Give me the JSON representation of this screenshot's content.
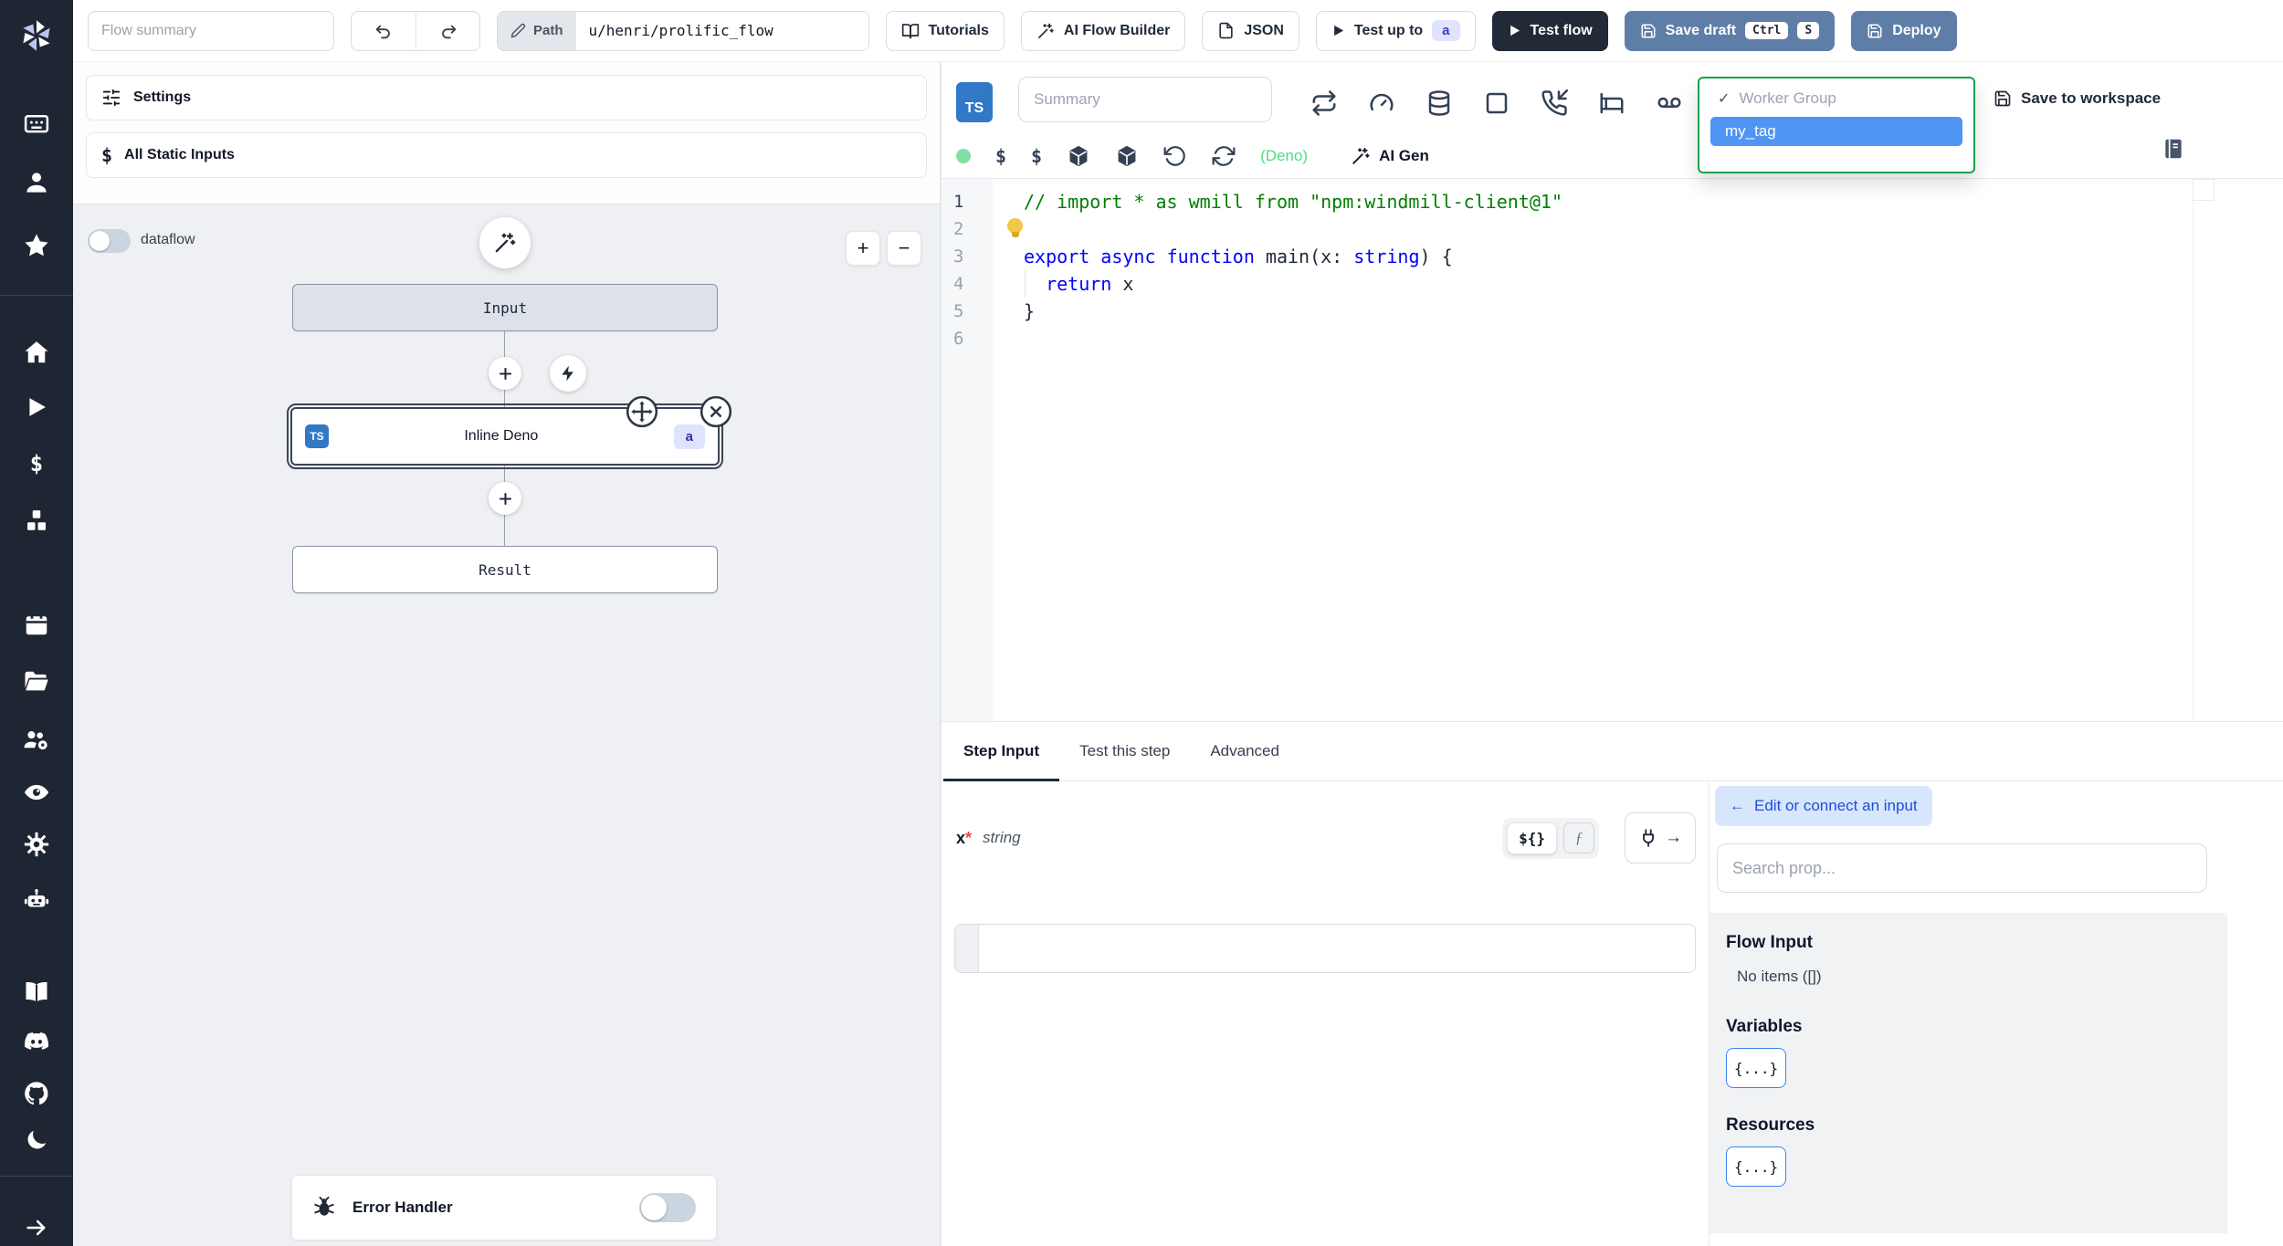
{
  "topbar": {
    "flow_summary_placeholder": "Flow summary",
    "path_label": "Path",
    "path_value": "u/henri/prolific_flow",
    "tutorials_label": "Tutorials",
    "ai_flow_builder_label": "AI Flow Builder",
    "json_label": "JSON",
    "test_up_to_label": "Test up to",
    "test_up_to_badge": "a",
    "test_flow_label": "Test flow",
    "save_draft_label": "Save draft",
    "save_draft_kbd": [
      "Ctrl",
      "S"
    ],
    "deploy_label": "Deploy"
  },
  "flow_panel": {
    "settings_label": "Settings",
    "all_static_inputs_label": "All Static Inputs",
    "dataflow_label": "dataflow",
    "zoom_in_label": "+",
    "zoom_out_label": "−",
    "error_handler_label": "Error Handler"
  },
  "graph": {
    "input_node_label": "Input",
    "step_node": {
      "lang_badge": "TS",
      "label": "Inline Deno",
      "id_badge": "a"
    },
    "result_node_label": "Result"
  },
  "editor": {
    "lang_badge": "TS",
    "summary_placeholder": "Summary",
    "language_indicator": "(Deno)",
    "ai_gen_label": "AI Gen",
    "dollar_glyph": "$",
    "worker_group": {
      "check": "✓",
      "placeholder_option": "Worker Group",
      "selected_option": "my_tag"
    },
    "save_to_workspace_label": "Save to workspace",
    "code": {
      "lines": [
        {
          "n": "1",
          "tokens": [
            {
              "t": "// import * as wmill from \"npm:windmill-client@1\"",
              "c": "comment"
            }
          ]
        },
        {
          "n": "2",
          "tokens": []
        },
        {
          "n": "3",
          "tokens": [
            {
              "t": "export",
              "c": "kw"
            },
            {
              "t": " ",
              "c": "p"
            },
            {
              "t": "async",
              "c": "kw"
            },
            {
              "t": " ",
              "c": "p"
            },
            {
              "t": "function",
              "c": "kw"
            },
            {
              "t": " main(x: ",
              "c": "p"
            },
            {
              "t": "string",
              "c": "kw"
            },
            {
              "t": ") {",
              "c": "p"
            }
          ]
        },
        {
          "n": "4",
          "tokens": [
            {
              "t": "  ",
              "c": "p"
            },
            {
              "t": "return",
              "c": "kw"
            },
            {
              "t": " x",
              "c": "p"
            }
          ]
        },
        {
          "n": "5",
          "tokens": [
            {
              "t": "}",
              "c": "p"
            }
          ]
        },
        {
          "n": "6",
          "tokens": []
        }
      ]
    }
  },
  "tabs": {
    "items": [
      "Step Input",
      "Test this step",
      "Advanced"
    ],
    "active": "Step Input"
  },
  "step_input": {
    "field_name": "x",
    "required_mark": "*",
    "field_type": "string",
    "template_toggle_label": "${}",
    "fn_toggle_label": "ƒ",
    "connect_arrow": "→",
    "value": ""
  },
  "prop_picker": {
    "back_arrow": "←",
    "edit_connect_label": "Edit or connect an input",
    "search_placeholder": "Search prop...",
    "sections": {
      "flow_input_title": "Flow Input",
      "flow_input_empty": "No items ([])",
      "variables_title": "Variables",
      "variables_value": "{...}",
      "resources_title": "Resources",
      "resources_value": "{...}"
    }
  },
  "icons": [
    "windmill-logo",
    "workspace-icon",
    "user-icon",
    "favorites-star-icon",
    "home-icon",
    "runs-play-icon",
    "variables-dollar-icon",
    "resources-cubes-icon",
    "schedules-calendar-icon",
    "folders-icon",
    "groups-icon",
    "audit-eye-icon",
    "settings-gear-icon",
    "ai-robot-icon",
    "docs-book-icon",
    "discord-icon",
    "github-icon",
    "dark-mode-moon-icon",
    "expand-arrow-icon",
    "undo-icon",
    "redo-icon",
    "pencil-icon",
    "book-open-icon",
    "wand-sparkles-icon",
    "file-json-icon",
    "play-icon",
    "save-icon",
    "sliders-icon",
    "retry-repeat-icon",
    "concurrency-gauge-icon",
    "cache-database-icon",
    "mock-square-icon",
    "suspend-phone-incoming-icon",
    "sleep-bed-icon",
    "pipe-voicemail-icon",
    "status-dot",
    "dollar-icon",
    "package-icon",
    "rotate-ccw-icon",
    "refresh-icon",
    "library-icon",
    "lightbulb-icon",
    "plus-icon",
    "lightning-icon",
    "move-icon",
    "close-icon",
    "bug-icon",
    "plug-icon",
    "magnifier-none"
  ],
  "colors": {
    "sidebar_bg": "#1f2633",
    "steel_button": "#5e7ea7",
    "dark_button": "#232a37",
    "ts_badge_blue": "#3178c6",
    "deno_green": "#4ade80",
    "status_green": "#7fe0a5",
    "selected_option_blue": "#5094f4",
    "dropdown_focus_green": "#16a34a",
    "badge_lavender_bg": "#dfe3fc",
    "badge_indigo_text": "#4338ca",
    "edit_connect_bg": "#d8e6fc",
    "edit_connect_text": "#1d4ed8",
    "code_keyword": "#0000ff",
    "code_comment": "#008000",
    "graph_bg": "#eef0f3"
  }
}
